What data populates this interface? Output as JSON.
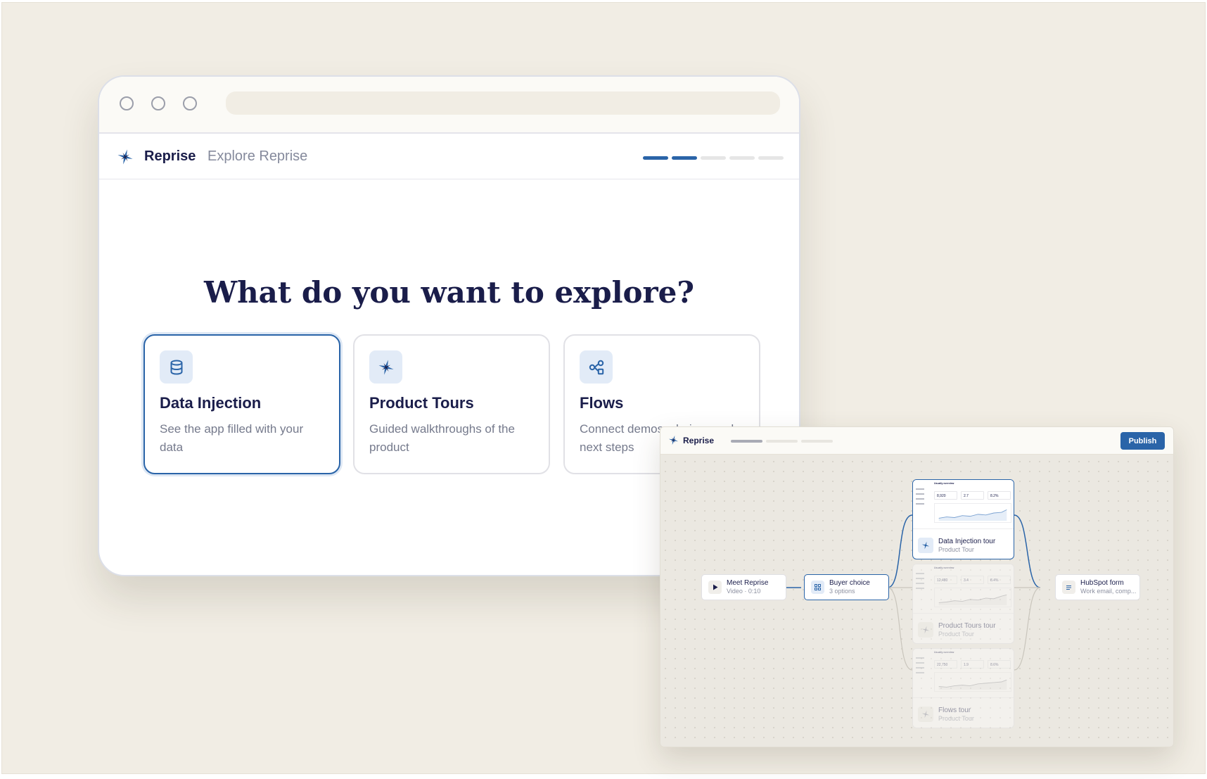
{
  "app": {
    "brand": "Reprise",
    "subtitle": "Explore Reprise",
    "progress": {
      "total": 5,
      "completed": 2
    }
  },
  "question": "What do you want to explore?",
  "cards": [
    {
      "title": "Data Injection",
      "description": "See the app filled with your data",
      "icon": "database-icon",
      "selected": true
    },
    {
      "title": "Product Tours",
      "description": "Guided walkthroughs of the product",
      "icon": "sparkle-icon",
      "selected": false
    },
    {
      "title": "Flows",
      "description": "Connect demos, choices and next steps",
      "icon": "flow-nodes-icon",
      "selected": false
    }
  ],
  "flow_editor": {
    "brand": "Reprise",
    "publish_label": "Publish",
    "nodes": [
      {
        "id": "meet",
        "title": "Meet Reprise",
        "subtitle": "Video · 0:10",
        "icon": "play-icon"
      },
      {
        "id": "choice",
        "title": "Buyer choice",
        "subtitle": "3 options",
        "icon": "grid-icon"
      },
      {
        "id": "hubspot",
        "title": "HubSpot form",
        "subtitle": "Work email, comp...",
        "icon": "form-lines-icon"
      }
    ],
    "tours": [
      {
        "title": "Data Injection tour",
        "subtitle": "Product Tour",
        "active": true,
        "preview": {
          "title": "Usually overview",
          "stats": [
            "8,920",
            "2.7",
            "8.2%"
          ]
        }
      },
      {
        "title": "Product Tours tour",
        "subtitle": "Product Tour",
        "active": false,
        "preview": {
          "title": "Usually overview",
          "stats": [
            "12,480",
            "3.4",
            "8.4%"
          ]
        }
      },
      {
        "title": "Flows tour",
        "subtitle": "Product Tour",
        "active": false,
        "preview": {
          "title": "Usually overview",
          "stats": [
            "22,750",
            "1.9",
            "8.6%"
          ]
        }
      }
    ]
  },
  "colors": {
    "accent": "#2a64a8",
    "ink": "#1a1d4a",
    "muted": "#757a8c",
    "canvas": "#f1ede4"
  }
}
